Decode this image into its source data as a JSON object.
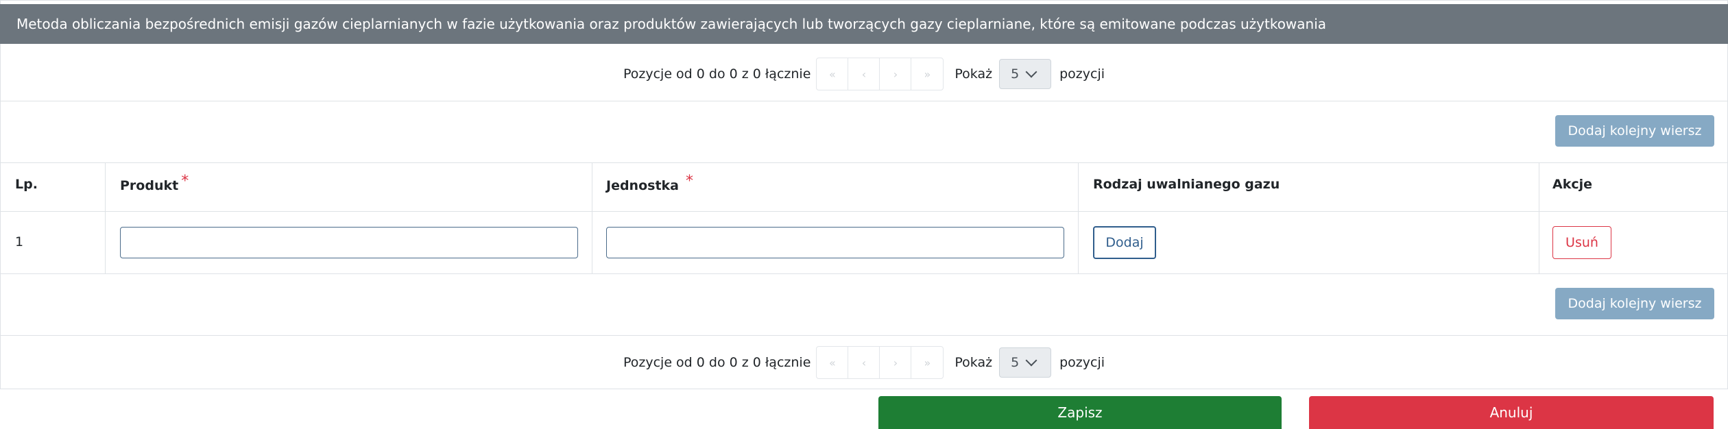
{
  "section": {
    "title": "Metoda obliczania bezpośrednich emisji gazów cieplarnianych w fazie użytkowania oraz produktów zawierających lub tworzących gazy cieplarniane, które są emitowane podczas użytkowania"
  },
  "pager_top": {
    "summary": "Pozycje od 0 do 0 z 0 łącznie",
    "show_label": "Pokaż",
    "page_size": "5",
    "items_label": "pozycji",
    "buttons": [
      "«",
      "‹",
      "›",
      "»"
    ]
  },
  "pager_bottom": {
    "summary": "Pozycje od 0 do 0 z 0 łącznie",
    "show_label": "Pokaż",
    "page_size": "5",
    "items_label": "pozycji",
    "buttons": [
      "«",
      "‹",
      "›",
      "»"
    ]
  },
  "add_row_label": "Dodaj kolejny wiersz",
  "table": {
    "columns": {
      "lp": "Lp.",
      "product": "Produkt",
      "unit": "Jednostka",
      "gas": "Rodzaj uwalnianego gazu",
      "actions": "Akcje"
    },
    "required_mark": "*",
    "rows": [
      {
        "lp": "1",
        "product": "",
        "unit": "",
        "add_label": "Dodaj",
        "remove_label": "Usuń"
      }
    ]
  },
  "footer": {
    "save_label": "Zapisz",
    "cancel_label": "Anuluj"
  }
}
